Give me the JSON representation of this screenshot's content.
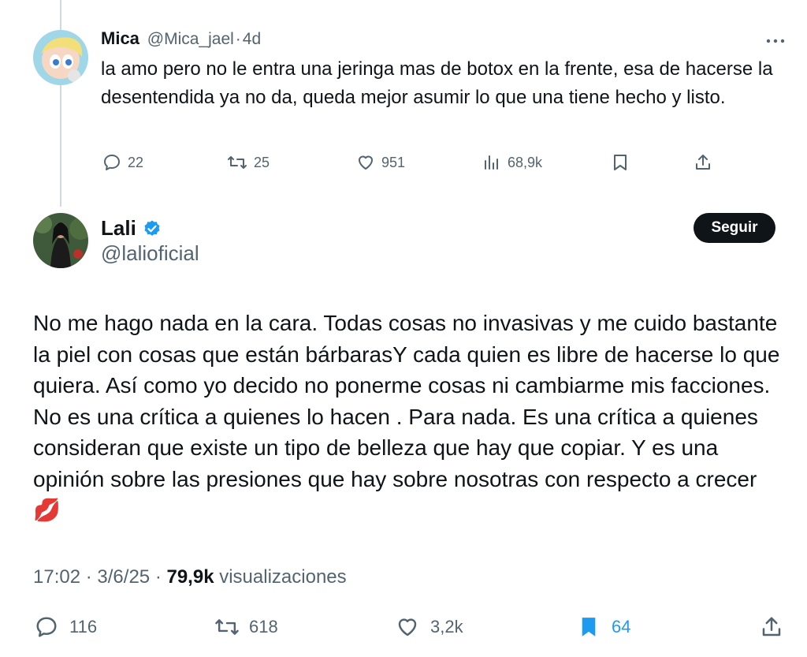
{
  "reply": {
    "display_name": "Mica",
    "handle": "@Mica_jael",
    "separator": "·",
    "time": "4d",
    "text": "la amo pero no le entra una jeringa mas de botox en la frente, esa de hacerse la desentendida ya no da, queda mejor asumir lo que una tiene hecho y listo.",
    "more_icon": "more-dots-icon",
    "actions": {
      "replies": "22",
      "reposts": "25",
      "likes": "951",
      "views": "68,9k"
    }
  },
  "tweet": {
    "display_name": "Lali",
    "verified_icon": "verified-badge-icon",
    "handle": "@lalioficial",
    "follow_label": "Seguir",
    "text": "No me hago nada en la cara. Todas cosas no invasivas y me cuido bastante la piel con cosas que están bárbarasY cada quien es libre de hacerse lo que quiera. Así como yo decido no ponerme cosas ni cambiarme mis facciones. No es una crítica a quienes lo hacen . Para nada. Es una crítica a quienes consideran que existe un tipo de belleza que hay que copiar. Y es una opinión sobre las presiones que hay sobre nosotras con respecto a crecer💋",
    "time": "17:02",
    "date": "3/6/25",
    "views_count": "79,9k",
    "views_label": "visualizaciones",
    "actions": {
      "replies": "116",
      "reposts": "618",
      "likes": "3,2k",
      "bookmarks": "64"
    },
    "bookmark_color": "#1d9bf0"
  },
  "colors": {
    "text": "#0f1419",
    "muted": "#536471",
    "accent": "#1d9bf0",
    "thread_line": "#cfd9de"
  }
}
